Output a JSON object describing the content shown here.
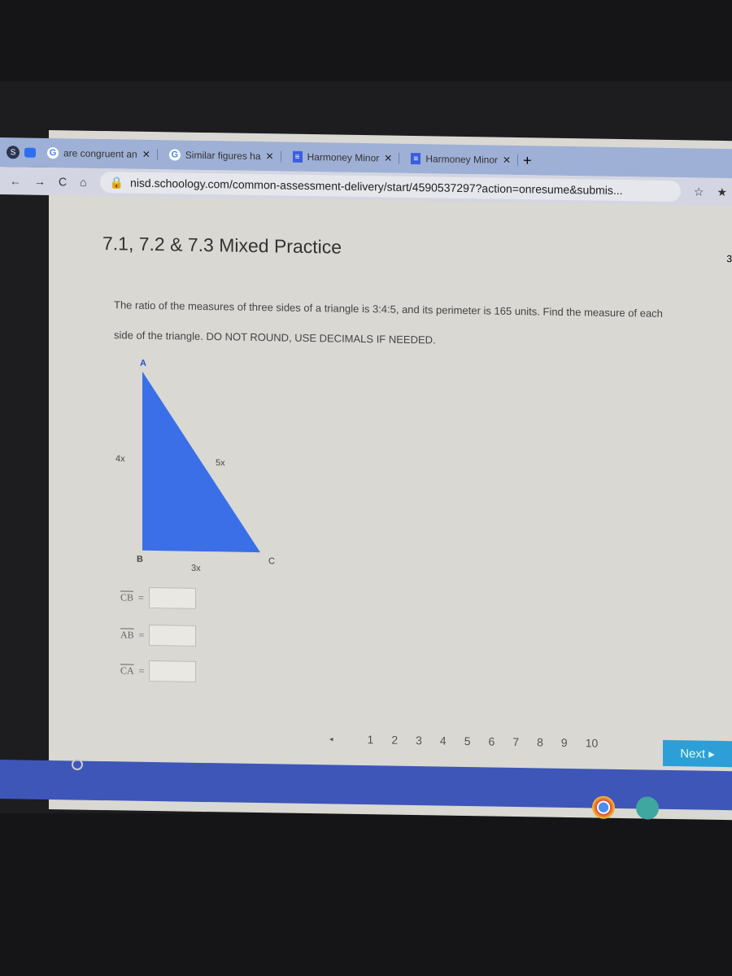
{
  "browser": {
    "tabs": [
      {
        "icon": "schoology-icon",
        "label": ""
      },
      {
        "icon": "zoom-icon",
        "label": ""
      },
      {
        "icon": "google-icon",
        "label": "are congruent an"
      },
      {
        "icon": "google-icon",
        "label": "Similar figures ha"
      },
      {
        "icon": "docs-icon",
        "label": "Harmoney Minor"
      },
      {
        "icon": "docs-icon",
        "label": "Harmoney Minor"
      }
    ],
    "new_tab": "+",
    "url": "nisd.schoology.com/common-assessment-delivery/start/4590537297?action=onresume&submis..."
  },
  "page": {
    "title": "7.1, 7.2 & 7.3 Mixed Practice",
    "side_number": "3",
    "question": "The ratio of the measures of three sides of a triangle is 3:4:5, and its perimeter is 165 units. Find the measure of each side of the triangle. DO NOT ROUND, USE DECIMALS IF NEEDED.",
    "figure": {
      "vertices": [
        "A",
        "B",
        "C"
      ],
      "sides": {
        "AB": "4x",
        "AC": "5x",
        "BC": "3x"
      },
      "fill": "#3b6fe8"
    },
    "answers": [
      {
        "label": "CB",
        "value": ""
      },
      {
        "label": "AB",
        "value": ""
      },
      {
        "label": "CA",
        "value": ""
      }
    ],
    "pager": {
      "prev": "◂",
      "pages": [
        "1",
        "2",
        "3",
        "4",
        "5",
        "6",
        "7",
        "8",
        "9",
        "10"
      ],
      "next": "Next ▸"
    }
  },
  "taskbar": {
    "apps": [
      "chrome-icon",
      "zoom-icon"
    ]
  }
}
